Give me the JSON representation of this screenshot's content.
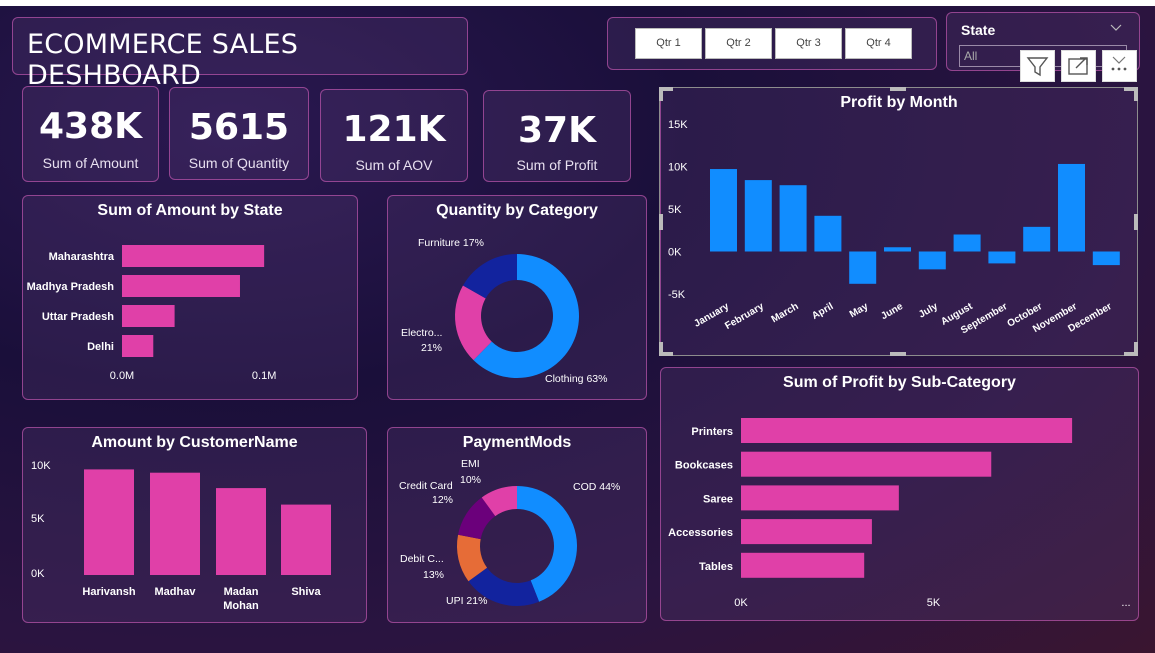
{
  "title": "ECOMMERCE SALES DESHBOARD",
  "quarters": [
    "Qtr 1",
    "Qtr 2",
    "Qtr 3",
    "Qtr 4"
  ],
  "state_slicer": {
    "label": "State",
    "value": "All"
  },
  "toolbar": {
    "filter_icon": "filter-icon",
    "focus_icon": "focus-mode-icon",
    "more_icon": "more-options-icon"
  },
  "kpis": [
    {
      "value": "438K",
      "label": "Sum of Amount"
    },
    {
      "value": "5615",
      "label": "Sum of Quantity"
    },
    {
      "value": "121K",
      "label": "Sum of AOV"
    },
    {
      "value": "37K",
      "label": "Sum of Profit"
    }
  ],
  "colors": {
    "pink": "#e040a8",
    "blue": "#118dff",
    "navy": "#12239e",
    "orange": "#e66c37",
    "purple": "#6b007b"
  },
  "chart_data": [
    {
      "id": "amount_by_state",
      "type": "bar",
      "orientation": "horizontal",
      "title": "Sum of Amount by State",
      "categories": [
        "Maharashtra",
        "Madhya Pradesh",
        "Uttar Pradesh",
        "Delhi"
      ],
      "values": [
        0.1,
        0.083,
        0.037,
        0.022
      ],
      "xticks": [
        "0.0M",
        "0.1M"
      ],
      "xlim": [
        0,
        0.14
      ]
    },
    {
      "id": "quantity_by_category",
      "type": "pie",
      "donut": true,
      "title": "Quantity by Category",
      "labels": [
        "Clothing",
        "Electro...",
        "Furniture"
      ],
      "values": [
        63,
        21,
        17
      ],
      "label_texts": [
        "Clothing 63%",
        "Electro...",
        "21%",
        "Furniture 17%"
      ]
    },
    {
      "id": "amount_by_customer",
      "type": "bar",
      "title": "Amount by CustomerName",
      "categories": [
        "Harivansh",
        "Madhav",
        "Madan Mohan",
        "Shiva"
      ],
      "category_lines": [
        [
          "Harivansh"
        ],
        [
          "Madhav"
        ],
        [
          "Madan",
          "Mohan"
        ],
        [
          "Shiva"
        ]
      ],
      "values": [
        9600,
        9300,
        7900,
        6400
      ],
      "yticks": [
        "10K",
        "5K",
        "0K"
      ],
      "ylim": [
        0,
        10000
      ]
    },
    {
      "id": "payment_mods",
      "type": "pie",
      "donut": true,
      "title": "PaymentMods",
      "labels": [
        "COD",
        "UPI",
        "Debit C...",
        "Credit Card",
        "EMI"
      ],
      "values": [
        44,
        21,
        13,
        12,
        10
      ],
      "label_texts": [
        "COD 44%",
        "UPI 21%",
        "Debit C...",
        "13%",
        "Credit Card",
        "12%",
        "EMI",
        "10%"
      ]
    },
    {
      "id": "profit_by_month",
      "type": "bar",
      "title": "Profit by Month",
      "categories": [
        "January",
        "February",
        "March",
        "April",
        "May",
        "June",
        "July",
        "August",
        "September",
        "October",
        "November",
        "December"
      ],
      "values": [
        9700,
        8400,
        7800,
        4200,
        -3800,
        500,
        -2100,
        2000,
        -1400,
        2900,
        10300,
        -1600
      ],
      "yticks": [
        "15K",
        "10K",
        "5K",
        "0K",
        "-5K"
      ],
      "ylim": [
        -5000,
        15000
      ]
    },
    {
      "id": "profit_by_subcategory",
      "type": "bar",
      "orientation": "horizontal",
      "title": "Sum of Profit by Sub-Category",
      "categories": [
        "Printers",
        "Bookcases",
        "Saree",
        "Accessories",
        "Tables"
      ],
      "values": [
        8600,
        6500,
        4100,
        3400,
        3200
      ],
      "xticks": [
        "0K",
        "5K"
      ],
      "xlim": [
        0,
        10000
      ],
      "more_label": "..."
    }
  ]
}
